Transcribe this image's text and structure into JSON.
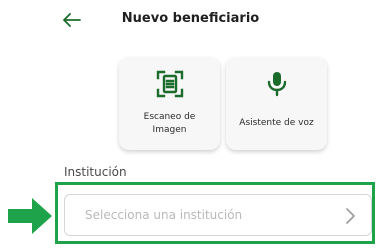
{
  "header": {
    "title": "Nuevo beneficiario",
    "back_icon": "arrow-left-icon"
  },
  "options": [
    {
      "label": "Escaneo de\nImagen",
      "icon": "document-scan-icon"
    },
    {
      "label": "Asistente de voz",
      "icon": "microphone-icon"
    }
  ],
  "institution": {
    "label": "Institución",
    "placeholder": "Selecciona una institución",
    "chevron_icon": "chevron-right-icon"
  },
  "colors": {
    "accent": "#1b6b2c",
    "highlight": "#1ea34a"
  }
}
